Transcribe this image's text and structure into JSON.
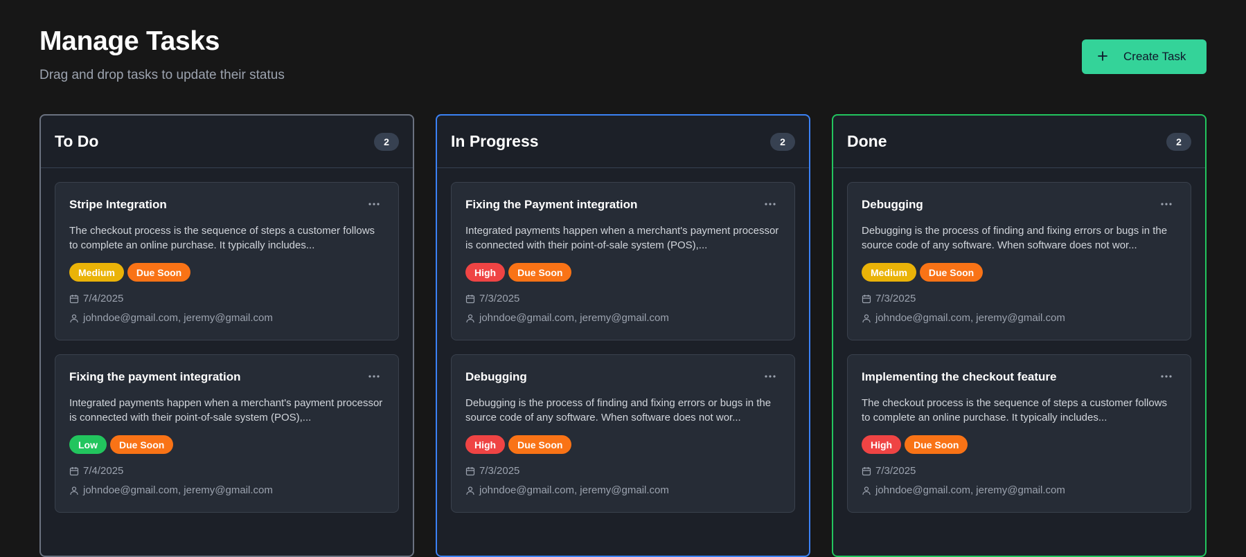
{
  "header": {
    "title": "Manage Tasks",
    "subtitle": "Drag and drop tasks to update their status",
    "create_button": "Create Task"
  },
  "colors": {
    "background": "#171717",
    "accent": "#34d399",
    "todo_border": "#6b7280",
    "inprogress_border": "#3b82f6",
    "done_border": "#22c55e",
    "priority_high": "#ef4444",
    "priority_medium": "#eab308",
    "priority_low": "#22c55e",
    "due_soon": "#f97316"
  },
  "columns": [
    {
      "title": "To Do",
      "count": "2",
      "cards": [
        {
          "title": "Stripe Integration",
          "description": "The checkout process is the sequence of steps a customer follows to complete an online purchase. It typically includes...",
          "priority": "Medium",
          "due": "Due Soon",
          "date": "7/4/2025",
          "assignees": "johndoe@gmail.com, jeremy@gmail.com"
        },
        {
          "title": "Fixing the payment integration",
          "description": "Integrated payments happen when a merchant's payment processor is connected with their point-of-sale system (POS),...",
          "priority": "Low",
          "due": "Due Soon",
          "date": "7/4/2025",
          "assignees": "johndoe@gmail.com, jeremy@gmail.com"
        }
      ]
    },
    {
      "title": "In Progress",
      "count": "2",
      "cards": [
        {
          "title": "Fixing the Payment integration",
          "description": "Integrated payments happen when a merchant's payment processor is connected with their point-of-sale system (POS),...",
          "priority": "High",
          "due": "Due Soon",
          "date": "7/3/2025",
          "assignees": "johndoe@gmail.com, jeremy@gmail.com"
        },
        {
          "title": "Debugging",
          "description": "Debugging is the process of finding and fixing errors or bugs in the source code of any software. When software does not wor...",
          "priority": "High",
          "due": "Due Soon",
          "date": "7/3/2025",
          "assignees": "johndoe@gmail.com, jeremy@gmail.com"
        }
      ]
    },
    {
      "title": "Done",
      "count": "2",
      "cards": [
        {
          "title": "Debugging",
          "description": "Debugging is the process of finding and fixing errors or bugs in the source code of any software. When software does not wor...",
          "priority": "Medium",
          "due": "Due Soon",
          "date": "7/3/2025",
          "assignees": "johndoe@gmail.com, jeremy@gmail.com"
        },
        {
          "title": "Implementing the checkout feature",
          "description": "The checkout process is the sequence of steps a customer follows to complete an online purchase. It typically includes...",
          "priority": "High",
          "due": "Due Soon",
          "date": "7/3/2025",
          "assignees": "johndoe@gmail.com, jeremy@gmail.com"
        }
      ]
    }
  ]
}
